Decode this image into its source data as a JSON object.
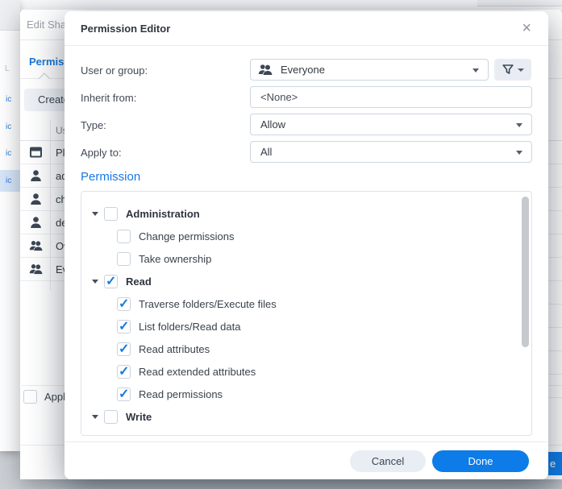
{
  "colors": {
    "accent_blue": "#1779e5",
    "primary_button_blue": "#0d7ce8",
    "link_blue": "#2a7de1"
  },
  "dialog": {
    "title": "Permission Editor",
    "close_glyph": "×",
    "fields": [
      {
        "label": "User or group:",
        "value": "Everyone"
      },
      {
        "label": "Inherit from:",
        "value": "<None>"
      },
      {
        "label": "Type:",
        "value": "Allow"
      },
      {
        "label": "Apply to:",
        "value": "All"
      }
    ],
    "permission_heading": "Permission",
    "tree": [
      {
        "label": "Administration",
        "level": 0,
        "group": true,
        "checked": false
      },
      {
        "label": "Change permissions",
        "level": 1,
        "checked": false
      },
      {
        "label": "Take ownership",
        "level": 1,
        "checked": false
      },
      {
        "label": "Read",
        "level": 0,
        "group": true,
        "checked": true
      },
      {
        "label": "Traverse folders/Execute files",
        "level": 1,
        "checked": true
      },
      {
        "label": "List folders/Read data",
        "level": 1,
        "checked": true
      },
      {
        "label": "Read attributes",
        "level": 1,
        "checked": true
      },
      {
        "label": "Read extended attributes",
        "level": 1,
        "checked": true
      },
      {
        "label": "Read permissions",
        "level": 1,
        "checked": true
      },
      {
        "label": "Write",
        "level": 0,
        "group": true,
        "checked": false
      },
      {
        "label": "",
        "level": 1,
        "checked": false,
        "partial": true
      }
    ],
    "cancel_label": "Cancel",
    "done_label": "Done"
  },
  "edit_window": {
    "title": "Edit Shar",
    "tab_label": "Permiss",
    "create_label": "Create",
    "table": {
      "header_label": "Us",
      "rows": [
        {
          "icon": "window",
          "label": "Ple"
        },
        {
          "icon": "user",
          "label": "ad"
        },
        {
          "icon": "user",
          "label": "ch"
        },
        {
          "icon": "user",
          "label": "de"
        },
        {
          "icon": "group",
          "label": "Ow"
        },
        {
          "icon": "group",
          "label": "Ev"
        }
      ]
    },
    "apply_label": "Appl",
    "save_fragment": "e"
  },
  "left_window": {
    "gray_fragment": "L",
    "items": [
      {
        "label": "ic",
        "highlighted": false
      },
      {
        "label": "ic",
        "highlighted": false
      },
      {
        "label": "ic",
        "highlighted": false
      },
      {
        "label": "ic",
        "highlighted": true
      }
    ]
  }
}
